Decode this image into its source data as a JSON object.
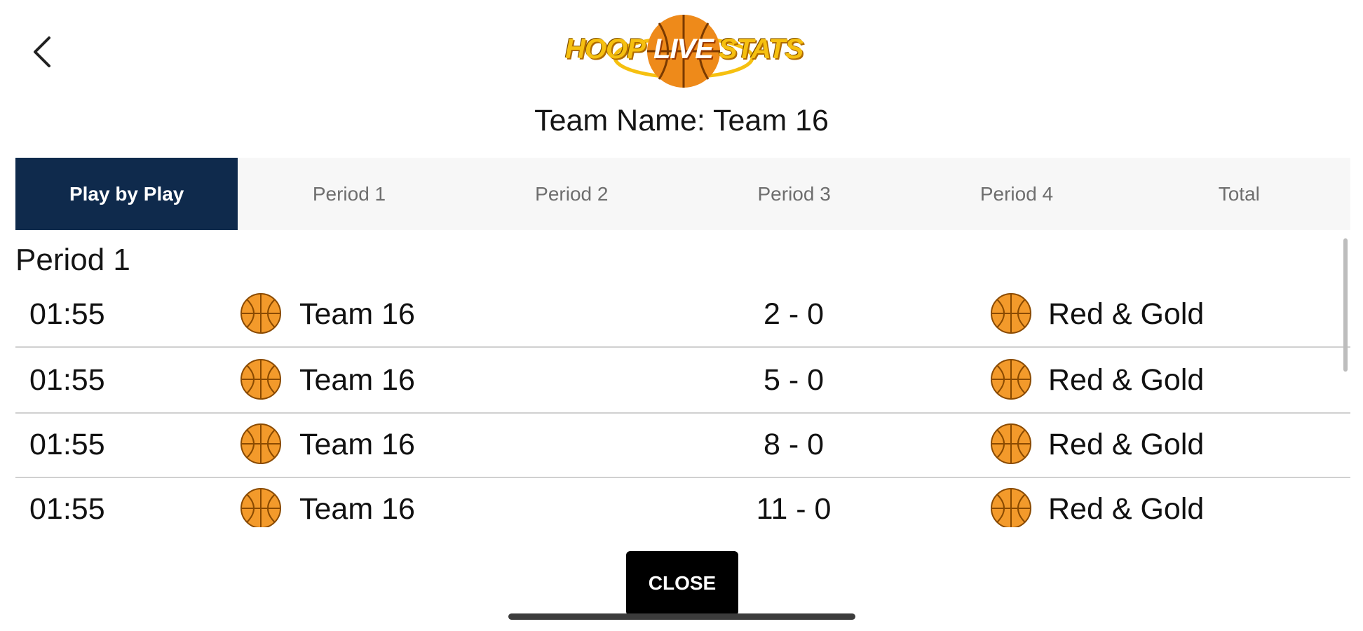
{
  "header": {
    "back_icon": "chevron-left-icon",
    "logo": {
      "left": "HOOP",
      "middle": "LIVE",
      "right": "STATS",
      "colors": {
        "yellow": "#f6c010",
        "orange": "#ee8a1a"
      }
    },
    "team_title": "Team Name: Team 16"
  },
  "tabs": [
    {
      "label": "Play by Play",
      "active": true
    },
    {
      "label": "Period 1",
      "active": false
    },
    {
      "label": "Period 2",
      "active": false
    },
    {
      "label": "Period 3",
      "active": false
    },
    {
      "label": "Period 4",
      "active": false
    },
    {
      "label": "Total",
      "active": false
    }
  ],
  "content": {
    "period_heading": "Period 1",
    "rows": [
      {
        "time": "01:55",
        "team": "Team 16",
        "score": "2 - 0",
        "opponent": "Red & Gold"
      },
      {
        "time": "01:55",
        "team": "Team 16",
        "score": "5 - 0",
        "opponent": "Red & Gold"
      },
      {
        "time": "01:55",
        "team": "Team 16",
        "score": "8 - 0",
        "opponent": "Red & Gold"
      },
      {
        "time": "01:55",
        "team": "Team 16",
        "score": "11 - 0",
        "opponent": "Red & Gold"
      }
    ]
  },
  "footer": {
    "close_label": "CLOSE"
  },
  "colors": {
    "tab_active_bg": "#0f2a4c",
    "ball": "#f39a2b"
  }
}
